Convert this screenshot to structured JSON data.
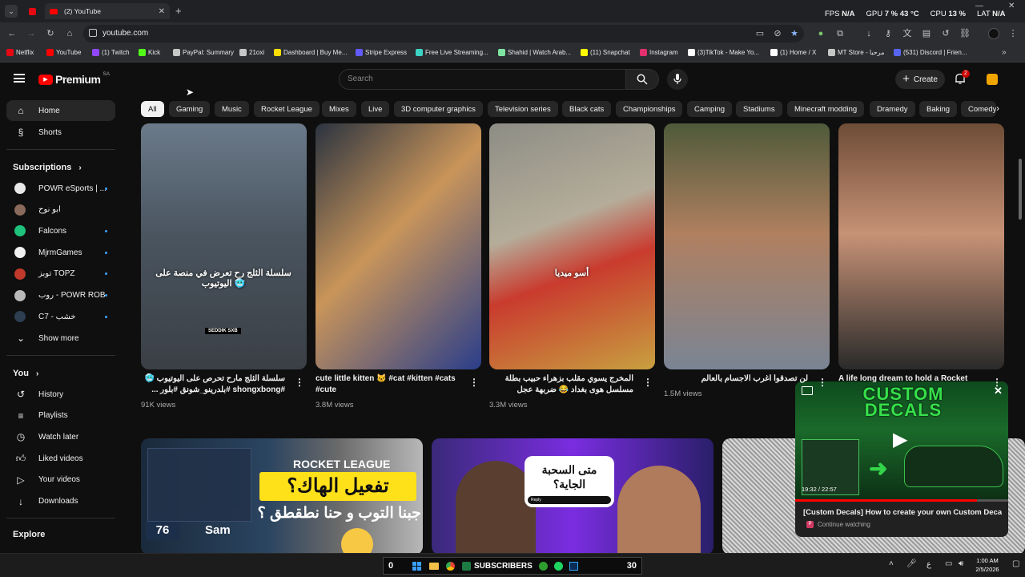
{
  "browser": {
    "tab_title": "(2) YouTube",
    "url": "youtube.com",
    "stats": [
      {
        "label": "FPS",
        "value": "N/A"
      },
      {
        "label": "GPU",
        "value": "7 %  43 °C"
      },
      {
        "label": "CPU",
        "value": "13 %"
      },
      {
        "label": "LAT",
        "value": "N/A"
      }
    ],
    "bookmarks": [
      {
        "label": "Netflix",
        "color": "#e50914"
      },
      {
        "label": "YouTube",
        "color": "#ff0000"
      },
      {
        "label": "(1) Twitch",
        "color": "#9146ff"
      },
      {
        "label": "Kick",
        "color": "#53fc18"
      },
      {
        "label": "PayPal: Summary",
        "color": "#c4c7c5"
      },
      {
        "label": "21oxi",
        "color": "#c4c7c5"
      },
      {
        "label": "Dashboard | Buy Me...",
        "color": "#ffdd00"
      },
      {
        "label": "Stripe Express",
        "color": "#635bff"
      },
      {
        "label": "Free Live Streaming...",
        "color": "#3bd3c3"
      },
      {
        "label": "Shahid | Watch Arab...",
        "color": "#7ee3a0"
      },
      {
        "label": "(11) Snapchat",
        "color": "#fffc00"
      },
      {
        "label": "Instagram",
        "color": "#e1306c"
      },
      {
        "label": "(3)TikTok - Make Yo...",
        "color": "#ffffff"
      },
      {
        "label": "(1) Home / X",
        "color": "#ffffff"
      },
      {
        "label": "MT Store - مرحبا",
        "color": "#c4c7c5"
      },
      {
        "label": "(531) Discord | Frien...",
        "color": "#5865f2"
      }
    ]
  },
  "header": {
    "logo_text": "Premium",
    "region": "SA",
    "search_placeholder": "Search",
    "create_label": "Create",
    "notification_count": "2"
  },
  "sidebar": {
    "main": [
      {
        "label": "Home",
        "icon": "home-icon"
      },
      {
        "label": "Shorts",
        "icon": "shorts-icon"
      }
    ],
    "subscriptions_title": "Subscriptions",
    "subscriptions": [
      {
        "label": "POWR eSports | ...",
        "color": "#e8e8e8",
        "dot": true
      },
      {
        "label": "ابو نوح",
        "color": "#8a6a5a",
        "dot": false
      },
      {
        "label": "Falcons",
        "color": "#1ec27a",
        "dot": true
      },
      {
        "label": "MjrmGames",
        "color": "#f1f1f1",
        "dot": true
      },
      {
        "label": "توبز TOPZ",
        "color": "#c0392b",
        "dot": true
      },
      {
        "label": "روب - POWR ROB",
        "color": "#b9b9b9",
        "dot": true
      },
      {
        "label": "C7 - خشب",
        "color": "#2c3e50",
        "dot": true
      }
    ],
    "show_more": "Show more",
    "you_title": "You",
    "you": [
      {
        "label": "History",
        "icon": "history-icon"
      },
      {
        "label": "Playlists",
        "icon": "playlists-icon"
      },
      {
        "label": "Watch later",
        "icon": "watch-later-icon"
      },
      {
        "label": "Liked videos",
        "icon": "thumbs-up-icon"
      },
      {
        "label": "Your videos",
        "icon": "your-videos-icon"
      },
      {
        "label": "Downloads",
        "icon": "download-icon"
      }
    ],
    "explore_title": "Explore"
  },
  "chips": [
    "All",
    "Gaming",
    "Music",
    "Rocket League",
    "Mixes",
    "Live",
    "3D computer graphics",
    "Television series",
    "Black cats",
    "Championships",
    "Camping",
    "Stadiums",
    "Minecraft modding",
    "Dramedy",
    "Baking",
    "Comedy"
  ],
  "shorts": [
    {
      "title": "سلسلة الثلج مارح تحرص على اليوتيوب 🥶 #shongxbong #بلدرينو_شونق #بلور ...",
      "views": "91K views",
      "overlay": "سلسلة الثلج رح تعرض في منصة على اليوتيوب 🥶",
      "tag": "SEDDIK SXB",
      "bg": "linear-gradient(180deg,#6b7a8a 0%,#4a5560 45%,#3a3f45 100%)"
    },
    {
      "title": "cute little kitten 🐱 #cat #kitten #cats #cute",
      "views": "3.8M views",
      "overlay": "",
      "tag": "",
      "bg": "linear-gradient(135deg,#2b3340 0%,#c9955a 45%,#2a3e8a 100%)"
    },
    {
      "title": "المخرج يسوي مقلب بزهراء حبيب بطلة مسلسل هوى بغداد 😂 ضربهة عجل",
      "views": "3.3M views",
      "overlay": "أسو ميديا",
      "tag": "",
      "bg": "linear-gradient(160deg,#8d8d85 0%,#b5ad9a 40%,#c93b2e 60%,#c8a040 100%)"
    },
    {
      "title": "لن تصدقوا اغرب الاجسام بالعالم",
      "views": "1.5M views",
      "overlay": "",
      "tag": "",
      "bg": "linear-gradient(180deg,#4e5a3a 0%,#b08060 45%,#7a8494 100%)"
    },
    {
      "title": "A life long dream to hold a Rocket",
      "views": "",
      "overlay": "",
      "tag": "",
      "bg": "linear-gradient(180deg,#6e4c36 0%,#c79276 45%,#2a2a2a 100%)"
    }
  ],
  "videos": [
    {
      "line1": "ROCKET LEAGUE",
      "line2": "تفعيل الهاك؟",
      "line3": "جبنا التوب و حنا نطقطق ؟",
      "score": "76",
      "player": "Sam"
    },
    {
      "bubble": "متى السحبة الجاية؟",
      "reply": "Reply"
    }
  ],
  "miniplayer": {
    "title_art": "CUSTOM DECALS",
    "time": "19:32 / 22:57",
    "video_title": "[Custom Decals] How to create your own Custom Decals ...",
    "status": "Continue watching",
    "progress": 0.853
  },
  "taskbar": {
    "left_num": "0",
    "subscribers_label": "SUBSCRIBERS",
    "right_num": "30",
    "time": "1:00 AM",
    "date": "2/5/2026",
    "lang": "ع"
  }
}
